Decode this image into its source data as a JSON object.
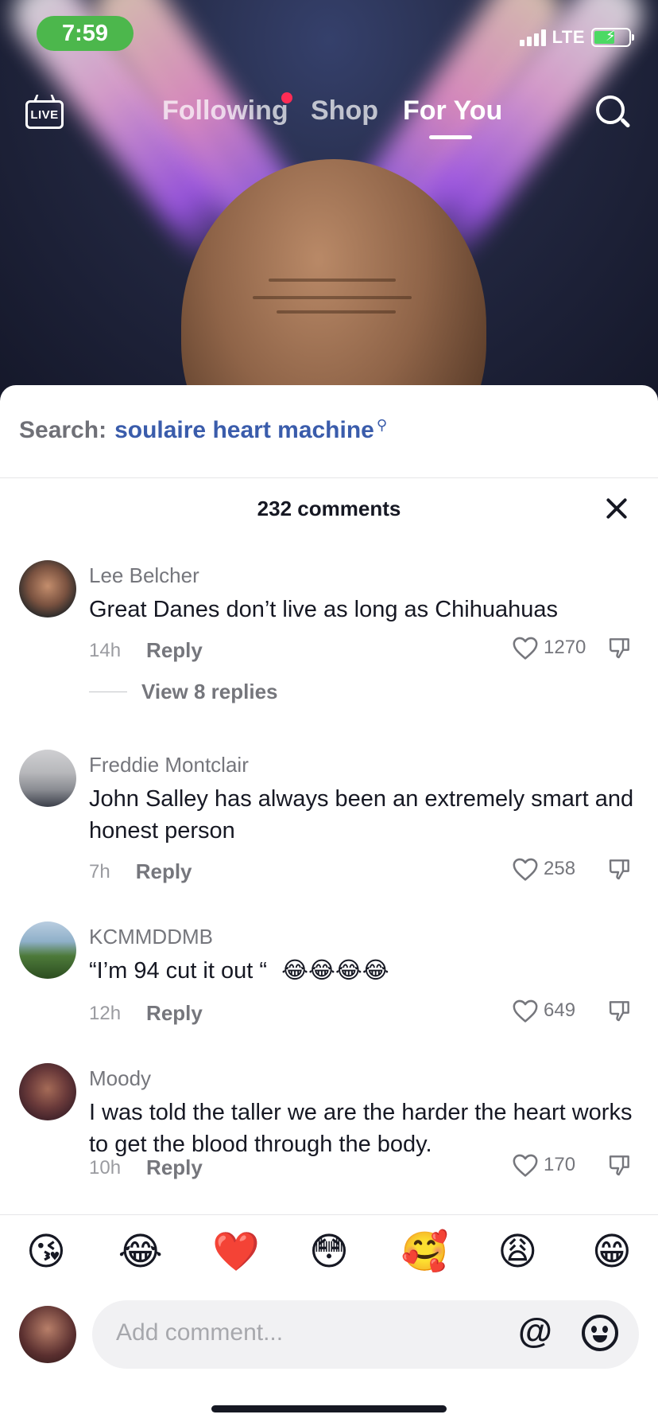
{
  "status_bar": {
    "time": "7:59",
    "network": "LTE",
    "battery_level": 0.55
  },
  "nav": {
    "live_label": "LIVE",
    "tabs": [
      {
        "label": "Following",
        "has_dot": true
      },
      {
        "label": "Shop"
      },
      {
        "label": "For You",
        "active": true
      }
    ],
    "accent_color": "#fe2c55"
  },
  "sheet": {
    "search_label": "Search:",
    "search_term": "soulaire heart machine",
    "comment_count": "232 comments",
    "comments": [
      {
        "username": "Lee Belcher",
        "text": "Great Danes don’t live as long as Chihuahuas",
        "age": "14h",
        "reply": "Reply",
        "likes": "1270",
        "view_replies": "View 8 replies"
      },
      {
        "username": "Freddie Montclair",
        "text": "John Salley has always been an extremely smart and honest person",
        "age": "7h",
        "reply": "Reply",
        "likes": "258"
      },
      {
        "username": "KCMMDDMB",
        "text": "“I’m 94 cut it out “",
        "age": "12h",
        "reply": "Reply",
        "likes": "649",
        "emoji": "😂😂😂😂"
      },
      {
        "username": "Moody",
        "text": "I was told the taller we are the harder the heart works to get the blood through the body.",
        "age": "10h",
        "reply": "Reply",
        "likes": "170"
      }
    ],
    "quick_emojis": [
      "😘",
      "😂",
      "❤️",
      "😳",
      "🥰",
      "😩",
      "😁"
    ],
    "input_placeholder": "Add comment...",
    "at_symbol": "@"
  }
}
